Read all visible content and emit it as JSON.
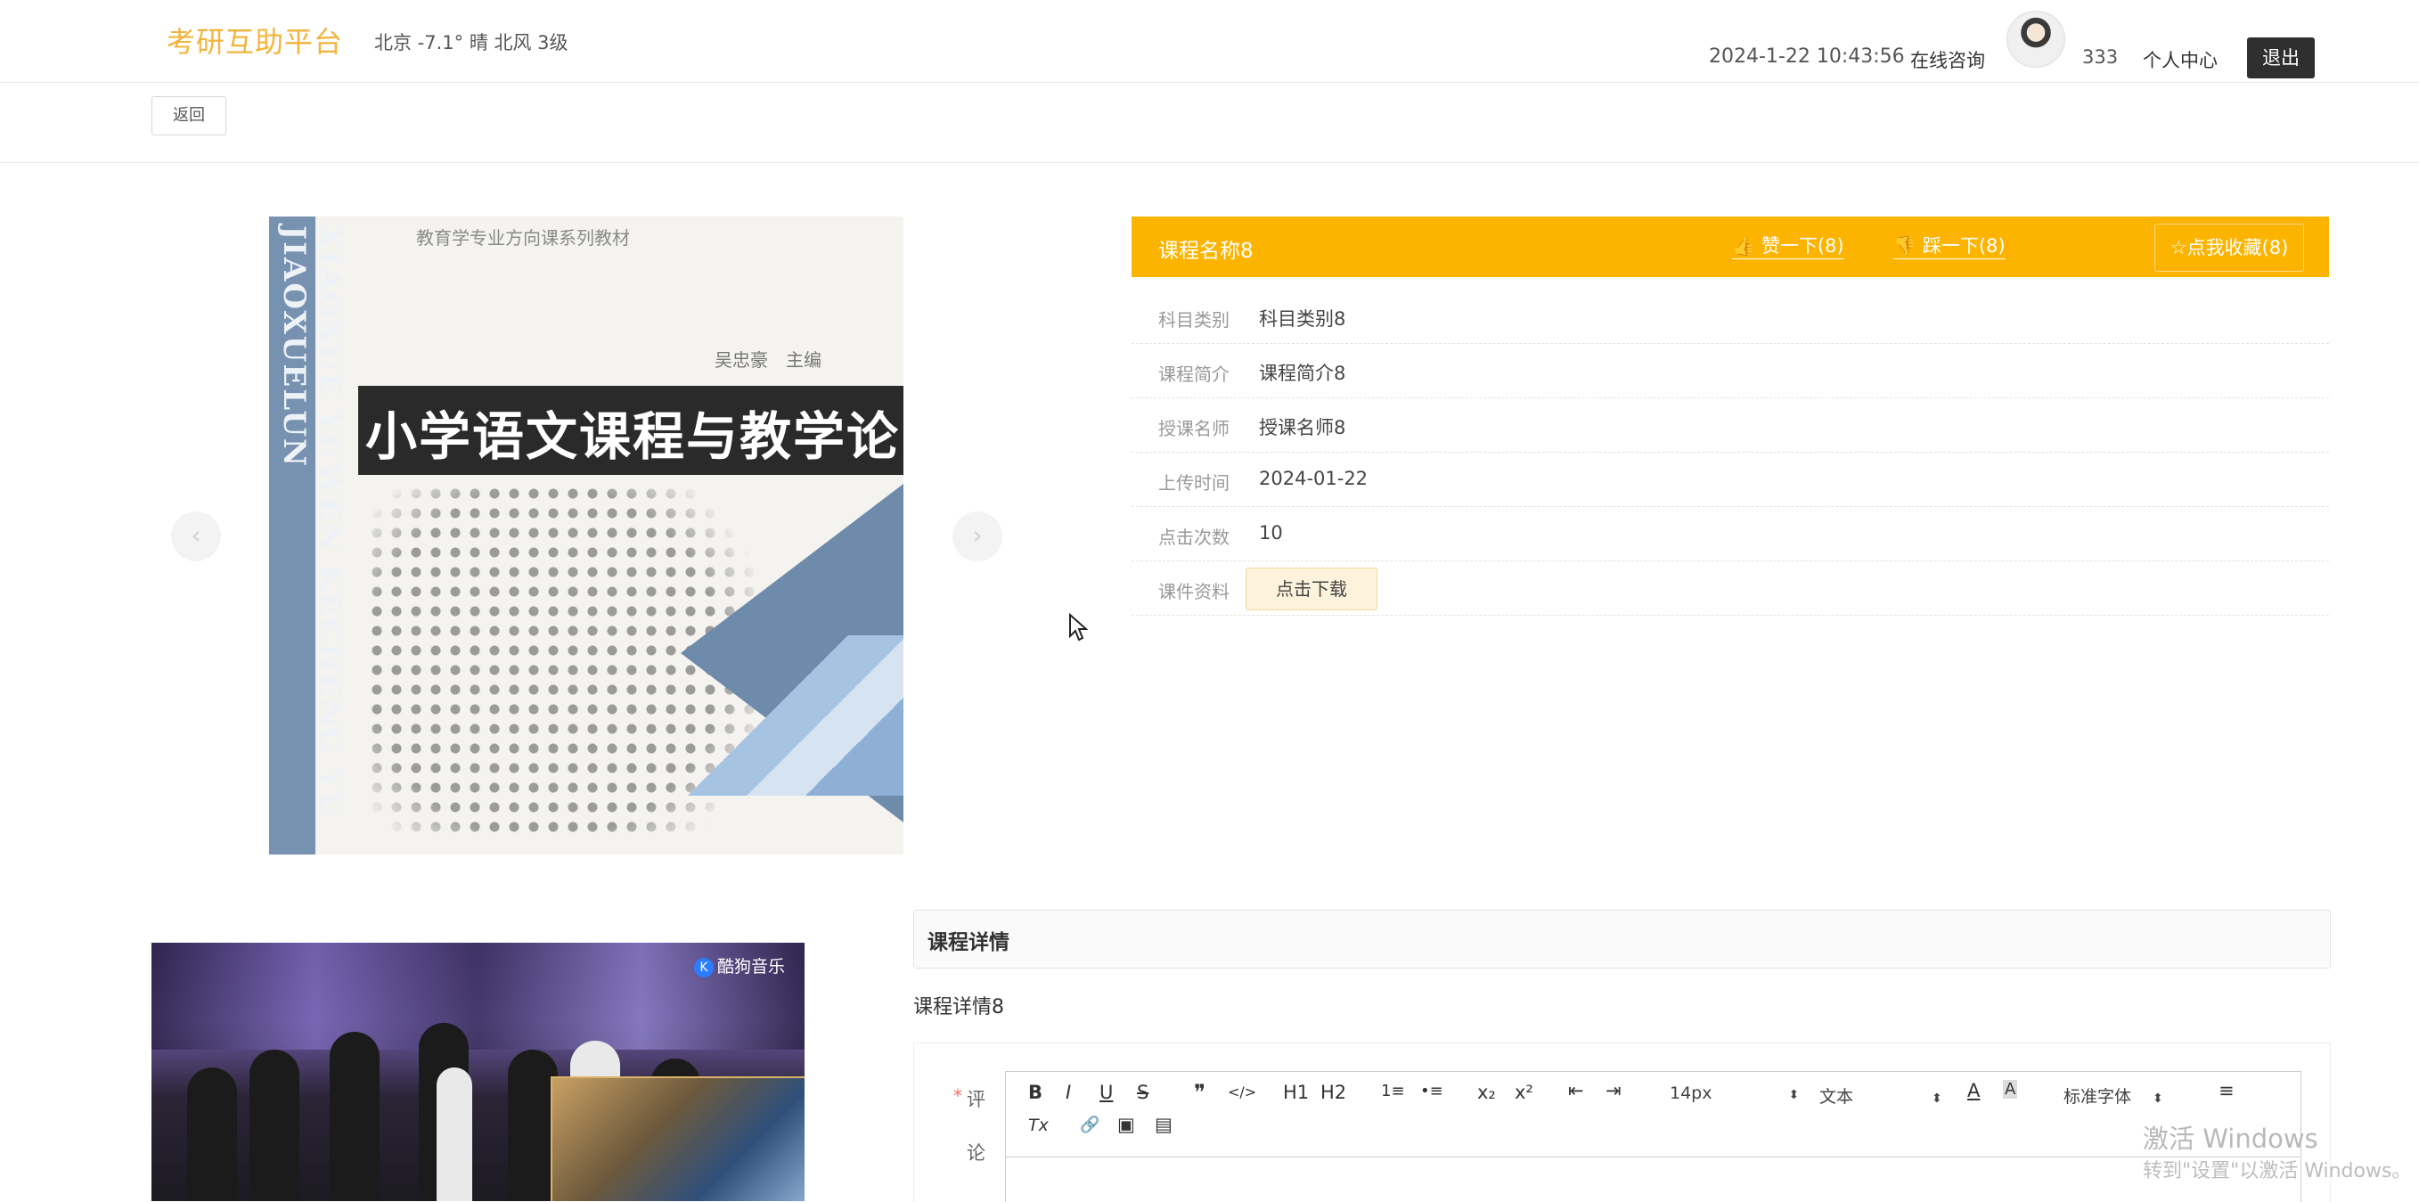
{
  "header": {
    "logo": "考研互助平台",
    "weather": "北京  -7.1°  晴  北风  3级",
    "datetime": "2024-1-22 10:43:56",
    "consult": "在线咨询",
    "username": "333",
    "user_center": "个人中心",
    "logout": "退出"
  },
  "back_button": "返回",
  "carousel": {
    "prev": "‹",
    "next": "›",
    "book": {
      "series": "教育学专业方向课系列教材",
      "author": "吴忠豪　主编",
      "title": "小学语文课程与教学论",
      "spine": "XIAOXUE YUWEN KECHENG YU JIAOXUELUN"
    }
  },
  "course": {
    "title": "课程名称8",
    "like": "赞一下(8)",
    "dislike": "踩一下(8)",
    "favorite": "点我收藏(8)",
    "rows": [
      {
        "label": "科目类别",
        "value": "科目类别8"
      },
      {
        "label": "课程简介",
        "value": "课程简介8"
      },
      {
        "label": "授课名师",
        "value": "授课名师8"
      },
      {
        "label": "上传时间",
        "value": "2024-01-22"
      },
      {
        "label": "点击次数",
        "value": "10"
      }
    ],
    "download_label": "课件资料",
    "download_button": "点击下载"
  },
  "video": {
    "watermark": "酷狗音乐",
    "watermark_icon": "K"
  },
  "details": {
    "heading": "课程详情",
    "content": "课程详情8"
  },
  "comment": {
    "required_mark": "*",
    "label_1": "评",
    "label_2": "论",
    "toolbar": {
      "bold": "B",
      "italic": "I",
      "underline": "U",
      "strike": "S",
      "quote": "❞",
      "code": "</>",
      "h1": "H1",
      "h2": "H2",
      "ordered_list": "1≡",
      "bullet_list": "•≡",
      "subscript": "x₂",
      "superscript": "x²",
      "outdent": "⇤",
      "indent": "⇥",
      "font_size": "14px",
      "text_style": "文本",
      "font_color": "A",
      "bg_color": "A",
      "font_family": "标准字体",
      "align": "≡",
      "clean": "Tx",
      "link": "🔗",
      "image": "▣",
      "video": "▤"
    }
  },
  "watermark": {
    "title": "激活 Windows",
    "subtitle": "转到\"设置\"以激活 Windows。"
  }
}
